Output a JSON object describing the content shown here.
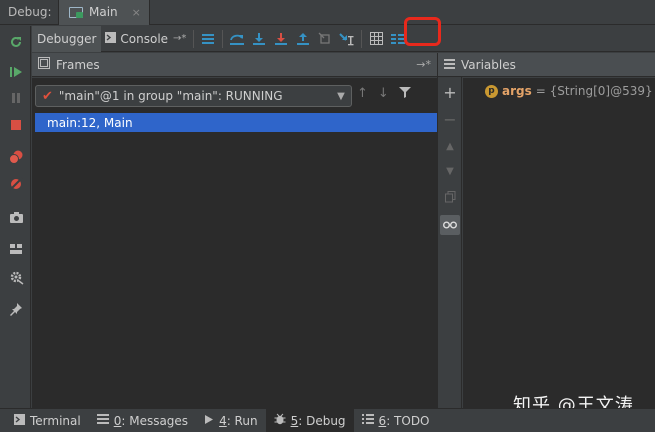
{
  "title_bar": {
    "label": "Debug:",
    "tab_label": "Main",
    "close_glyph": "×"
  },
  "toolbar": {
    "tabs": [
      {
        "label": "Debugger",
        "icon": "none",
        "active": true
      },
      {
        "label": "Console",
        "icon": "console-icon",
        "active": false
      }
    ],
    "console_pin_glyph": "→*",
    "buttons": [
      "show-execution-point-icon",
      "step-over-icon",
      "step-into-icon",
      "force-step-into-icon",
      "step-out-icon",
      "drop-frame-icon",
      "run-to-cursor-icon",
      "evaluate-expression-icon",
      "restore-layout-icon"
    ],
    "highlight_color": "#e8291c"
  },
  "left_toolbar": {
    "buttons": [
      "rerun-icon",
      "resume-icon",
      "pause-icon",
      "stop-icon",
      "view-breakpoints-icon",
      "mute-breakpoints-icon",
      "camera-icon",
      "layout-icon",
      "settings-icon",
      "pin-icon"
    ]
  },
  "frames_panel": {
    "title": "Frames",
    "thread_selector_value": "\"main\"@1 in group \"main\": RUNNING",
    "rows": [
      {
        "label": "main:12, Main",
        "selected": true
      }
    ],
    "selection_color": "#2f65ca"
  },
  "variables_panel": {
    "title": "Variables",
    "items": [
      {
        "badge": "p",
        "name": "args",
        "value": "= {String[0]@539}"
      }
    ]
  },
  "status_bar": {
    "items": [
      {
        "icon": "terminal-icon",
        "label": "Terminal",
        "prefix": "",
        "active": false
      },
      {
        "icon": "messages-icon",
        "prefix": "0",
        "label": ": Messages",
        "active": false
      },
      {
        "icon": "run-icon",
        "prefix": "4",
        "label": ": Run",
        "active": false
      },
      {
        "icon": "debug-icon",
        "prefix": "5",
        "label": ": Debug",
        "active": true
      },
      {
        "icon": "todo-icon",
        "prefix": "6",
        "label": ": TODO",
        "active": false
      }
    ]
  },
  "watermark": "知乎 @王文涛",
  "colors": {
    "background": "#3c3f41",
    "panel": "#2b2b2b",
    "accent_blue": "#3592c4"
  }
}
